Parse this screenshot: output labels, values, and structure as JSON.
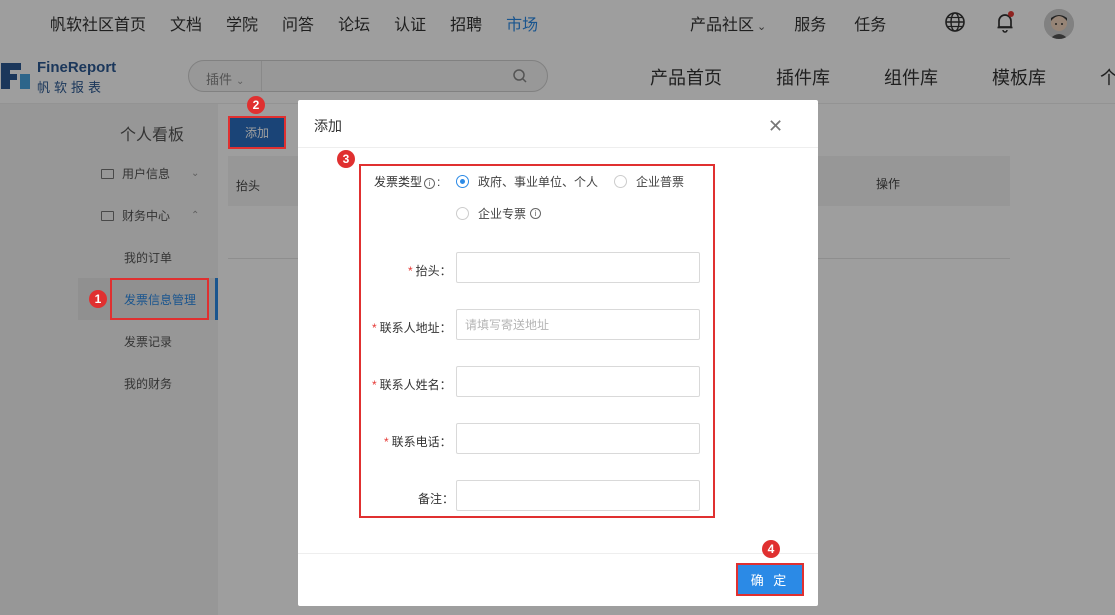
{
  "topnav": {
    "links": [
      "帆软社区首页",
      "文档",
      "学院",
      "问答",
      "论坛",
      "认证",
      "招聘",
      "市场"
    ],
    "active_link": "市场",
    "right_links": [
      "产品社区",
      "服务",
      "任务"
    ]
  },
  "logo": {
    "title": "FineReport",
    "subtitle": "帆软报表"
  },
  "search": {
    "category": "插件",
    "placeholder": ""
  },
  "subnav": [
    "产品首页",
    "插件库",
    "组件库",
    "模板库",
    "个"
  ],
  "sidebar": {
    "title": "个人看板",
    "group_user": "用户信息",
    "group_finance": "财务中心",
    "items": [
      "我的订单",
      "发票信息管理",
      "发票记录",
      "我的财务"
    ]
  },
  "main": {
    "add_button": "添加",
    "col_header": "抬头",
    "col_action": "操作"
  },
  "modal": {
    "title": "添加",
    "invoice_type_label": "发票类型",
    "options": [
      "政府、事业单位、个人",
      "企业普票",
      "企业专票"
    ],
    "selected_option": "政府、事业单位、个人",
    "fields": {
      "header_label": "抬头：",
      "address_label": "联系人地址：",
      "address_placeholder": "请填写寄送地址",
      "name_label": "联系人姓名：",
      "phone_label": "联系电话：",
      "note_label": "备注："
    },
    "confirm_button": "确 定"
  },
  "annotations": {
    "n1": "1",
    "n2": "2",
    "n3": "3",
    "n4": "4"
  },
  "colors": {
    "accent": "#2b8ae6",
    "annotation": "#e03030",
    "logo": "#2d5a94"
  }
}
